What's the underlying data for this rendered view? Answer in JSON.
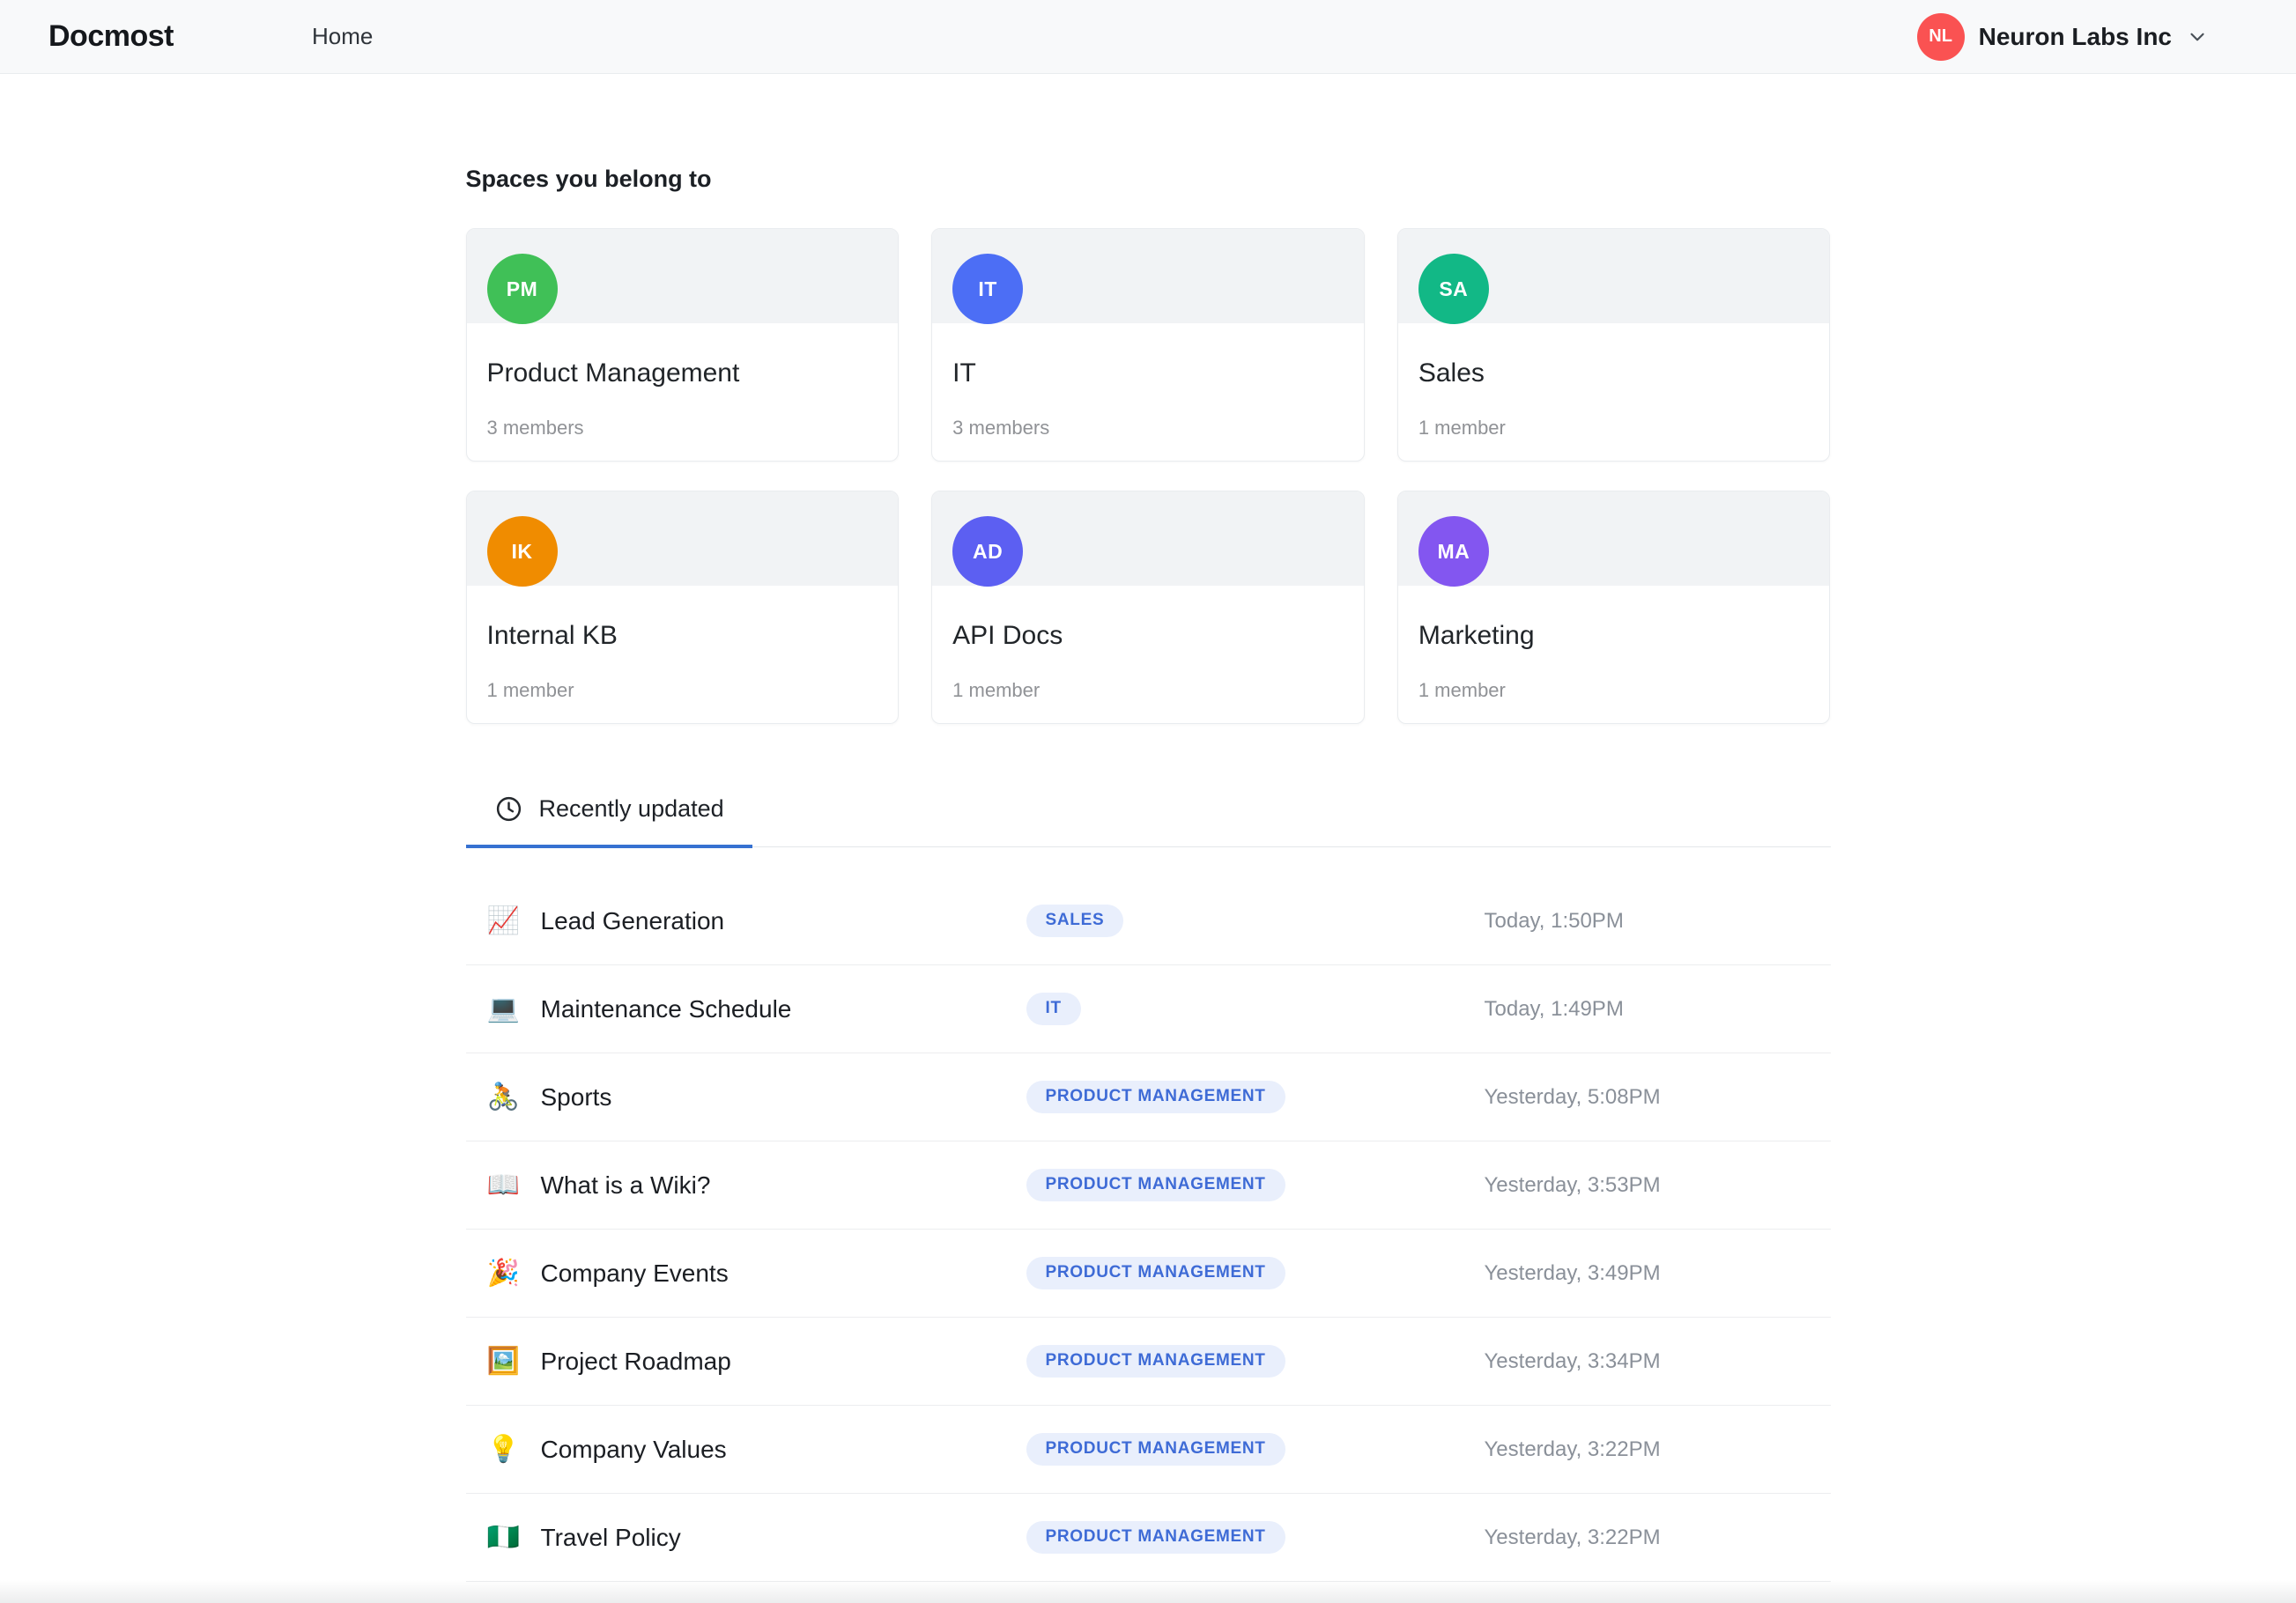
{
  "colors": {
    "accent": "#3671d1",
    "badge-bg": "#e9effc",
    "badge-text": "#3e6bd6",
    "header-bg": "#f8f9fa"
  },
  "header": {
    "brand": "Docmost",
    "nav_home": "Home",
    "workspace": {
      "name": "Neuron Labs Inc",
      "initials": "NL",
      "color": "#fa5252"
    }
  },
  "spaces": {
    "title": "Spaces you belong to",
    "items": [
      {
        "initials": "PM",
        "color": "#40c057",
        "name": "Product Management",
        "members": "3 members"
      },
      {
        "initials": "IT",
        "color": "#4c6ef5",
        "name": "IT",
        "members": "3 members"
      },
      {
        "initials": "SA",
        "color": "#12b886",
        "name": "Sales",
        "members": "1 member"
      },
      {
        "initials": "IK",
        "color": "#f08c00",
        "name": "Internal KB",
        "members": "1 member"
      },
      {
        "initials": "AD",
        "color": "#5c5ff2",
        "name": "API Docs",
        "members": "1 member"
      },
      {
        "initials": "MA",
        "color": "#8356f0",
        "name": "Marketing",
        "members": "1 member"
      }
    ]
  },
  "tabs": {
    "recently_updated": "Recently updated"
  },
  "pages": {
    "items": [
      {
        "emoji": "📈",
        "title": "Lead Generation",
        "badge": "SALES",
        "time": "Today, 1:50PM"
      },
      {
        "emoji": "💻",
        "title": "Maintenance Schedule",
        "badge": "IT",
        "time": "Today, 1:49PM"
      },
      {
        "emoji": "🚴",
        "title": "Sports",
        "badge": "PRODUCT MANAGEMENT",
        "time": "Yesterday, 5:08PM"
      },
      {
        "emoji": "📖",
        "title": "What is a Wiki?",
        "badge": "PRODUCT MANAGEMENT",
        "time": "Yesterday, 3:53PM"
      },
      {
        "emoji": "🎉",
        "title": "Company Events",
        "badge": "PRODUCT MANAGEMENT",
        "time": "Yesterday, 3:49PM"
      },
      {
        "emoji": "🖼️",
        "title": "Project Roadmap",
        "badge": "PRODUCT MANAGEMENT",
        "time": "Yesterday, 3:34PM"
      },
      {
        "emoji": "💡",
        "title": "Company Values",
        "badge": "PRODUCT MANAGEMENT",
        "time": "Yesterday, 3:22PM"
      },
      {
        "emoji": "🇳🇬",
        "title": "Travel Policy",
        "badge": "PRODUCT MANAGEMENT",
        "time": "Yesterday, 3:22PM"
      }
    ]
  }
}
